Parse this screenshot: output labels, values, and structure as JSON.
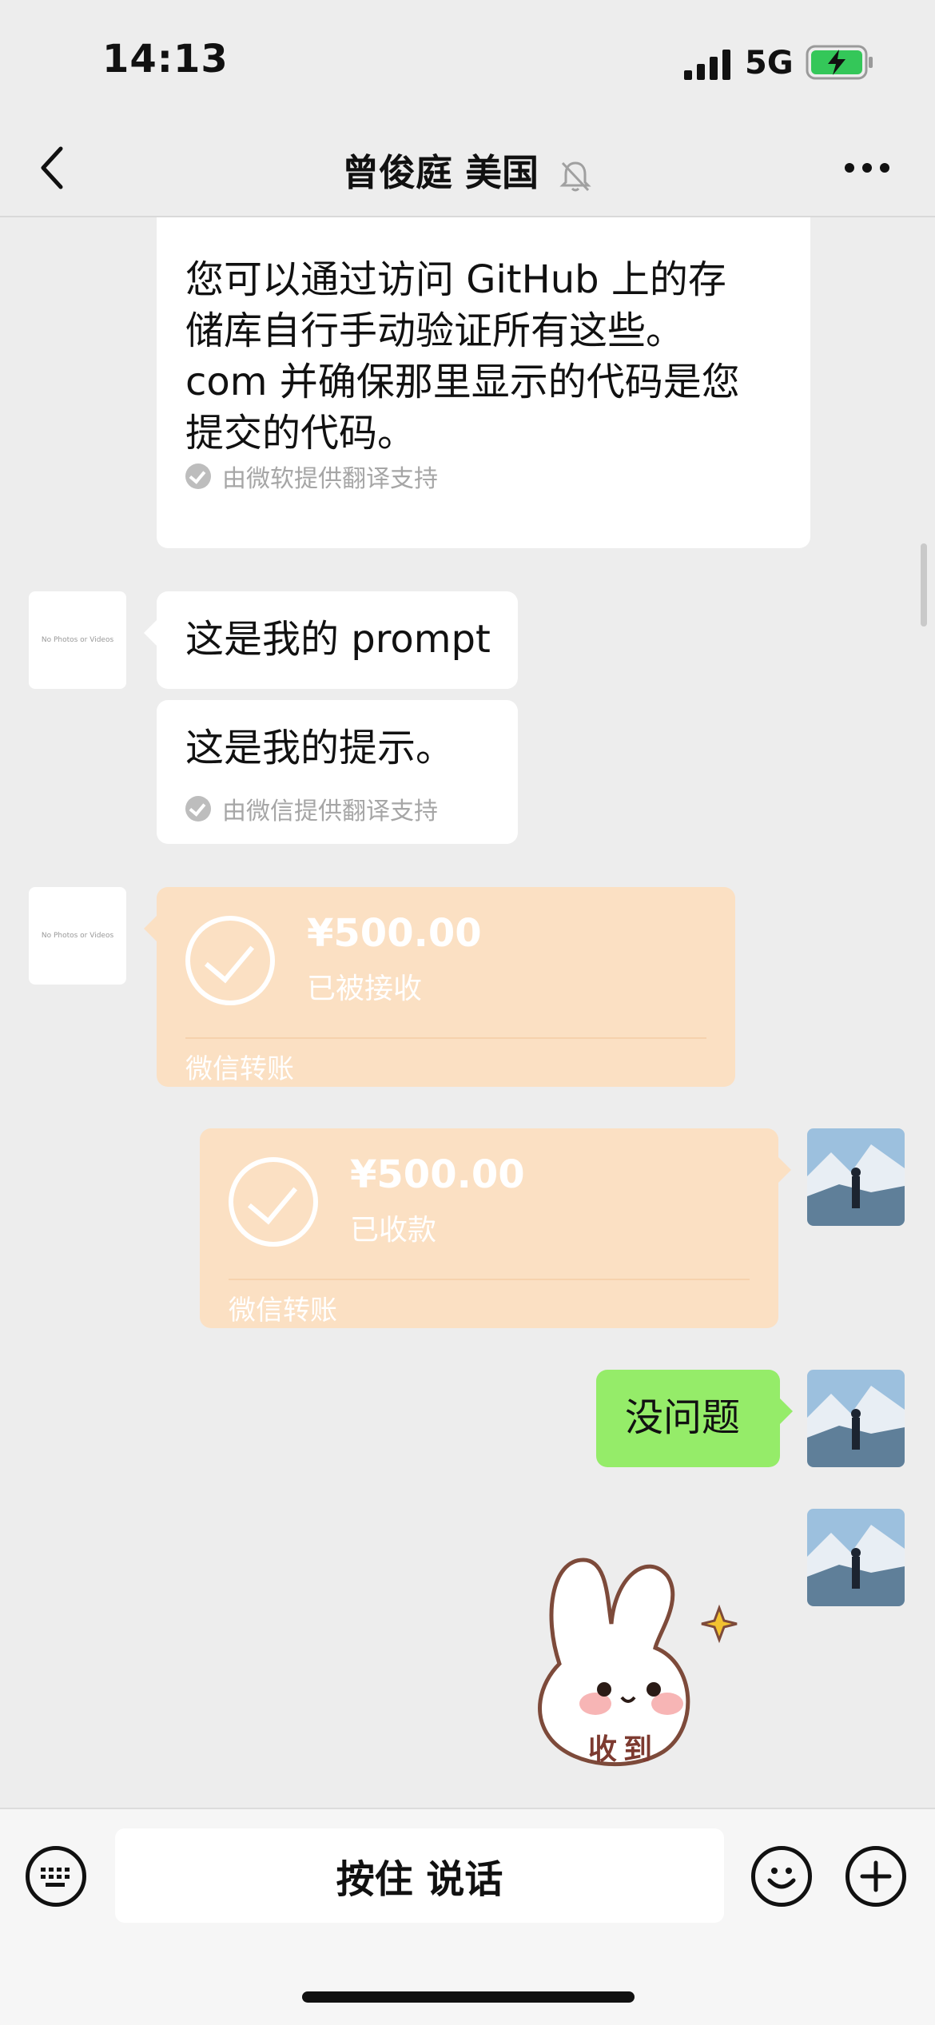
{
  "status_bar": {
    "time": "14:13",
    "network": "5G"
  },
  "nav": {
    "title": "曾俊庭 美国"
  },
  "messages": {
    "m1_translation_lines": [
      "您可以通过访问 GitHub 上的存",
      "储库自行手动验证所有这些。",
      "com 并确保那里显示的代码是您",
      "提交的代码。"
    ],
    "m1_note": "由微软提供翻译支持",
    "m2_text": "这是我的 prompt",
    "m2_translation": "这是我的提示。",
    "m2_note": "由微信提供翻译支持",
    "avatar_placeholder": "No Photos or Videos",
    "t1_amount": "¥500.00",
    "t1_status": "已被接收",
    "t1_label": "微信转账",
    "t2_amount": "¥500.00",
    "t2_status": "已收款",
    "t2_label": "微信转账",
    "m3_text": "没问题",
    "sticker_text": "收到"
  },
  "input_bar": {
    "voice_label": "按住 说话"
  },
  "colors": {
    "background": "#ededed",
    "bubble_white": "#ffffff",
    "bubble_green": "#95ec69",
    "transfer_orange": "#fbe0c3",
    "battery_green": "#34c759"
  },
  "icons": [
    "back-icon",
    "mute-bell-icon",
    "more-icon",
    "signal-icon",
    "battery-icon",
    "keyboard-icon",
    "emoji-icon",
    "plus-icon",
    "check-icon"
  ]
}
